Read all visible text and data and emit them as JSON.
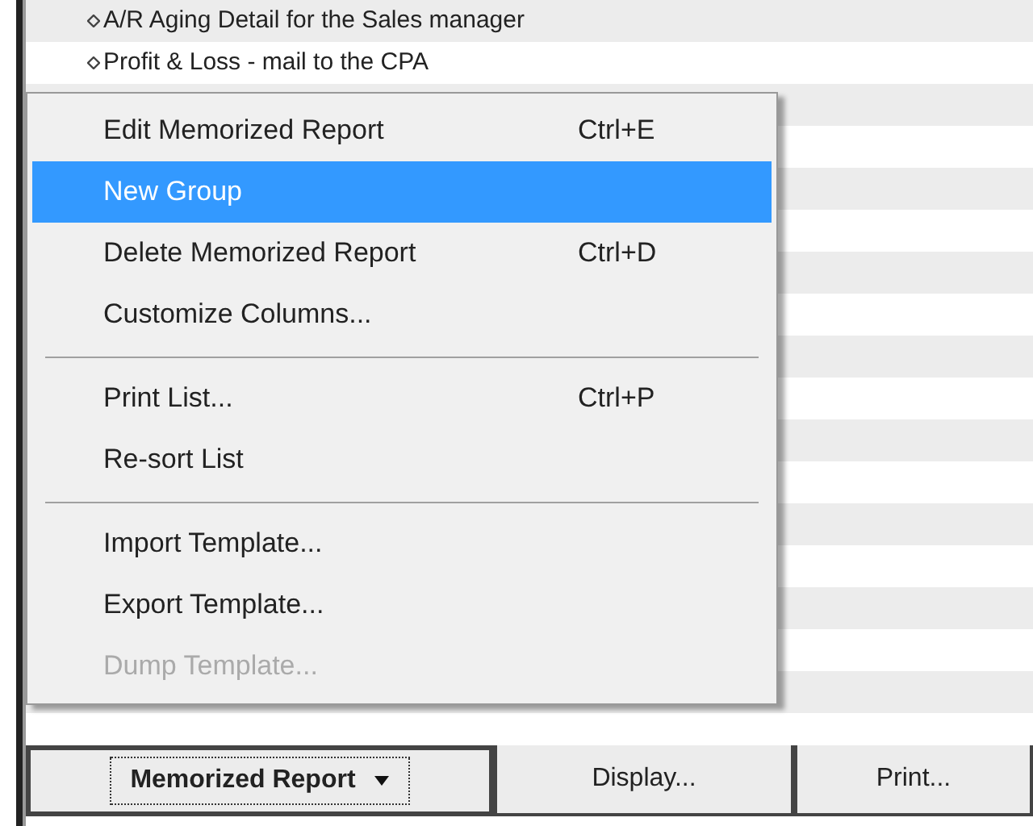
{
  "list": {
    "items": [
      {
        "label": "A/R Aging Detail for the Sales manager"
      },
      {
        "label": "Profit & Loss - mail to the CPA"
      }
    ]
  },
  "context_menu": {
    "items": [
      {
        "kind": "item",
        "label": "Edit Memorized Report",
        "shortcut": "Ctrl+E",
        "selected": false,
        "disabled": false
      },
      {
        "kind": "item",
        "label": "New Group",
        "selected": true,
        "disabled": false
      },
      {
        "kind": "item",
        "label": "Delete Memorized Report",
        "shortcut": "Ctrl+D",
        "selected": false,
        "disabled": false
      },
      {
        "kind": "item",
        "label": "Customize Columns...",
        "selected": false,
        "disabled": false
      },
      {
        "kind": "separator"
      },
      {
        "kind": "item",
        "label": "Print List...",
        "shortcut": "Ctrl+P",
        "selected": false,
        "disabled": false
      },
      {
        "kind": "item",
        "label": "Re-sort List",
        "selected": false,
        "disabled": false
      },
      {
        "kind": "separator"
      },
      {
        "kind": "item",
        "label": "Import Template...",
        "selected": false,
        "disabled": false
      },
      {
        "kind": "item",
        "label": "Export Template...",
        "selected": false,
        "disabled": false
      },
      {
        "kind": "item",
        "label": "Dump Template...",
        "selected": false,
        "disabled": true
      }
    ]
  },
  "buttons": [
    {
      "label": "Memorized Report",
      "dropdown": true,
      "focused": true
    },
    {
      "label": "Display...",
      "dropdown": false,
      "focused": false
    },
    {
      "label": "Print...",
      "dropdown": false,
      "focused": false
    }
  ]
}
